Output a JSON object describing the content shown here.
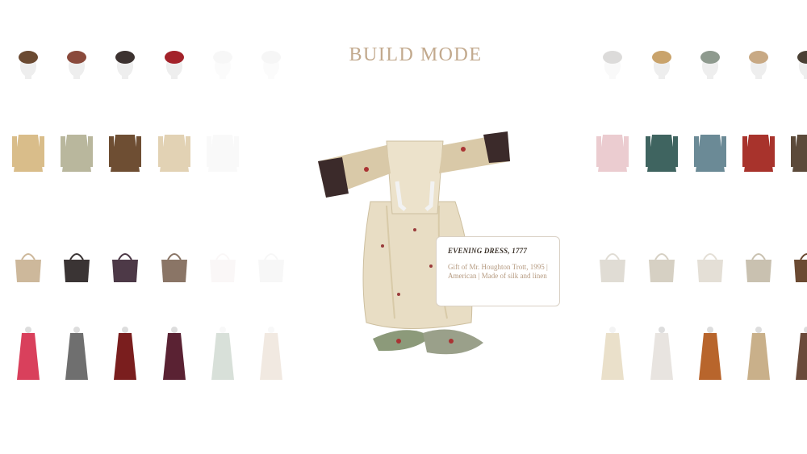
{
  "header": {
    "title": "BUILD MODE"
  },
  "selected_item": {
    "title": "EVENING DRESS, 1777",
    "description": "Gift of Mr. Houghton Trott, 1995 | American | Made of silk and linen"
  },
  "left_grid": {
    "rows": [
      [
        {
          "name": "fur-cap",
          "color": "#6b4a32"
        },
        {
          "name": "red-cap",
          "color": "#8a4a3c"
        },
        {
          "name": "black-bonnet",
          "color": "#3c3230"
        },
        {
          "name": "red-hat",
          "color": "#a3222a"
        },
        {
          "name": "white-cap",
          "color": "#d8d8d8"
        },
        {
          "name": "partial-hat",
          "color": "#cfcfcf"
        }
      ],
      [
        {
          "name": "corset",
          "color": "#d9bd8a"
        },
        {
          "name": "sage-jacket",
          "color": "#b9b79d"
        },
        {
          "name": "fur-coat",
          "color": "#6e4e33"
        },
        {
          "name": "cream-coat",
          "color": "#e2d2b4"
        },
        {
          "name": "faded-coat",
          "color": "#e0e0e0"
        }
      ],
      [
        {
          "name": "straw-hat",
          "color": "#cdb89b"
        },
        {
          "name": "black-handbag",
          "color": "#3a3434"
        },
        {
          "name": "purple-cape",
          "color": "#4d3947"
        },
        {
          "name": "fur-stole",
          "color": "#8a7566"
        },
        {
          "name": "faded-item",
          "color": "#e7d8d8"
        },
        {
          "name": "partial-item",
          "color": "#d6d6d6"
        }
      ],
      [
        {
          "name": "pink-gown",
          "color": "#d9405c"
        },
        {
          "name": "sketch-figure",
          "color": "#6f6f6f"
        },
        {
          "name": "red-black-dress",
          "color": "#7a1e1e"
        },
        {
          "name": "burgundy-dress",
          "color": "#5a2233"
        },
        {
          "name": "green-skirt",
          "color": "#2f5a32"
        },
        {
          "name": "partial-dress",
          "color": "#b88a60"
        }
      ]
    ]
  },
  "right_grid": {
    "rows": [
      [
        {
          "name": "faded-hat",
          "color": "#9e9a96"
        },
        {
          "name": "feather-bonnet",
          "color": "#c9a36b"
        },
        {
          "name": "teal-bonnet",
          "color": "#8e9a8e"
        },
        {
          "name": "fur-hat",
          "color": "#c8a984"
        },
        {
          "name": "partial-hat-right",
          "color": "#4a4035"
        }
      ],
      [
        {
          "name": "faded-jacket",
          "color": "#c7707a"
        },
        {
          "name": "teal-jacket",
          "color": "#3f6460"
        },
        {
          "name": "blue-bodice",
          "color": "#6b8a96"
        },
        {
          "name": "red-bodice",
          "color": "#a8332c"
        },
        {
          "name": "partial-bodice",
          "color": "#5c4a3a"
        }
      ],
      [
        {
          "name": "faded-gloves",
          "color": "#a89c86"
        },
        {
          "name": "white-collar",
          "color": "#d6d0c3"
        },
        {
          "name": "lace-collar",
          "color": "#e4dfd6"
        },
        {
          "name": "beige-bag",
          "color": "#c9c1b0"
        },
        {
          "name": "brown-garment",
          "color": "#6b4a32"
        }
      ],
      [
        {
          "name": "gold-gown",
          "color": "#c4a86a"
        },
        {
          "name": "white-gown",
          "color": "#e8e4e0"
        },
        {
          "name": "orange-gown",
          "color": "#b8652c"
        },
        {
          "name": "beige-gown",
          "color": "#c9b08a"
        },
        {
          "name": "partial-gown",
          "color": "#6a4a3a"
        }
      ]
    ]
  }
}
